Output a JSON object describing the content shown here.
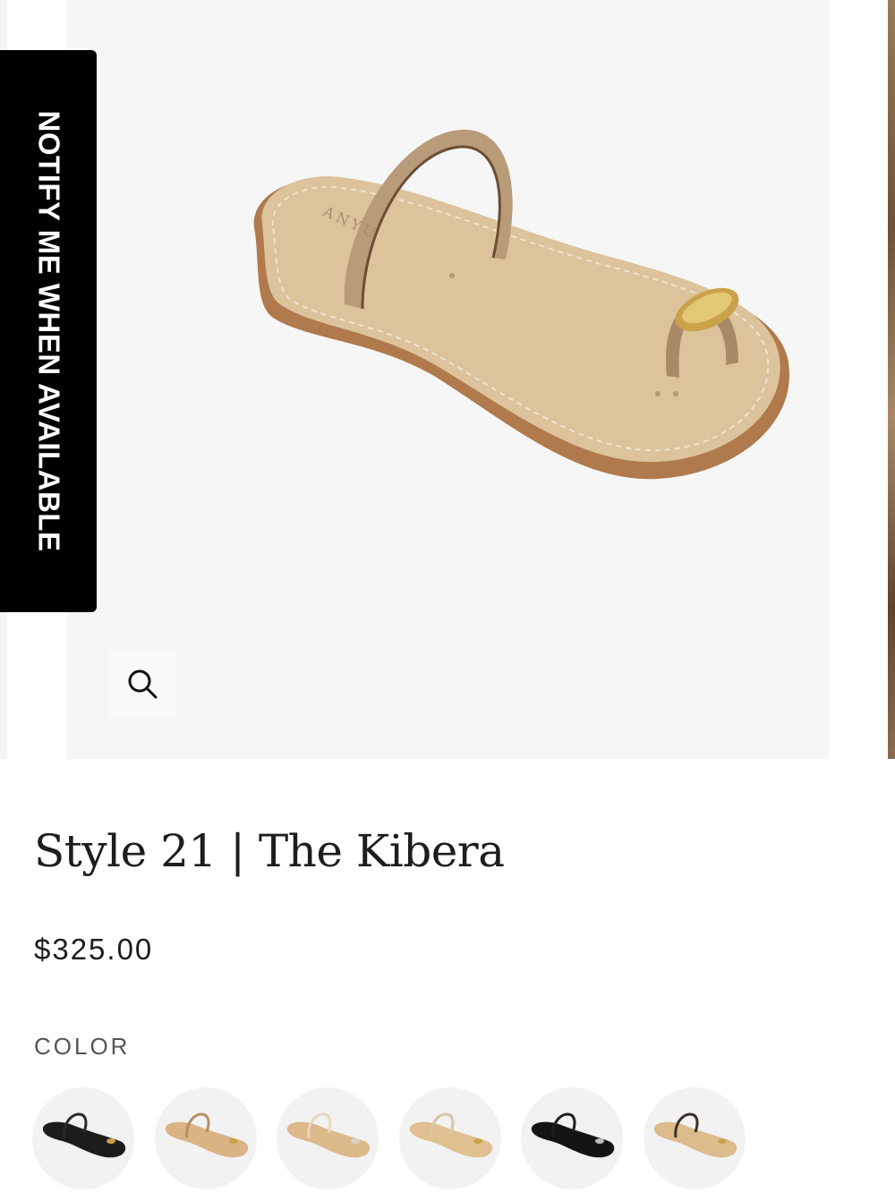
{
  "notify": {
    "label": "NOTIFY ME WHEN AVAILABLE"
  },
  "product": {
    "title": "Style 21 | The Kibera",
    "price": "$325.00",
    "image_alt": "Style 21 The Kibera sandal",
    "brand_mark": "ANYU"
  },
  "color": {
    "label": "COLOR",
    "swatches": [
      {
        "name": "swatch-1",
        "sole": "#1c1c1c",
        "strap": "#2a2a2a",
        "ring": "#c9a24a"
      },
      {
        "name": "swatch-2",
        "sole": "#d9b586",
        "strap": "#b88f62",
        "ring": "#c9a24a"
      },
      {
        "name": "swatch-3",
        "sole": "#dcb98b",
        "strap": "#e7d8c0",
        "ring": "#d9d3c4"
      },
      {
        "name": "swatch-4",
        "sole": "#e0c090",
        "strap": "#d8c6a6",
        "ring": "#c9a24a"
      },
      {
        "name": "swatch-5",
        "sole": "#141414",
        "strap": "#1e1e1e",
        "ring": "#bdbdbd"
      },
      {
        "name": "swatch-6",
        "sole": "#dcbc8c",
        "strap": "#3a3028",
        "ring": "#c9a24a"
      }
    ]
  },
  "icons": {
    "zoom": "search-icon"
  }
}
